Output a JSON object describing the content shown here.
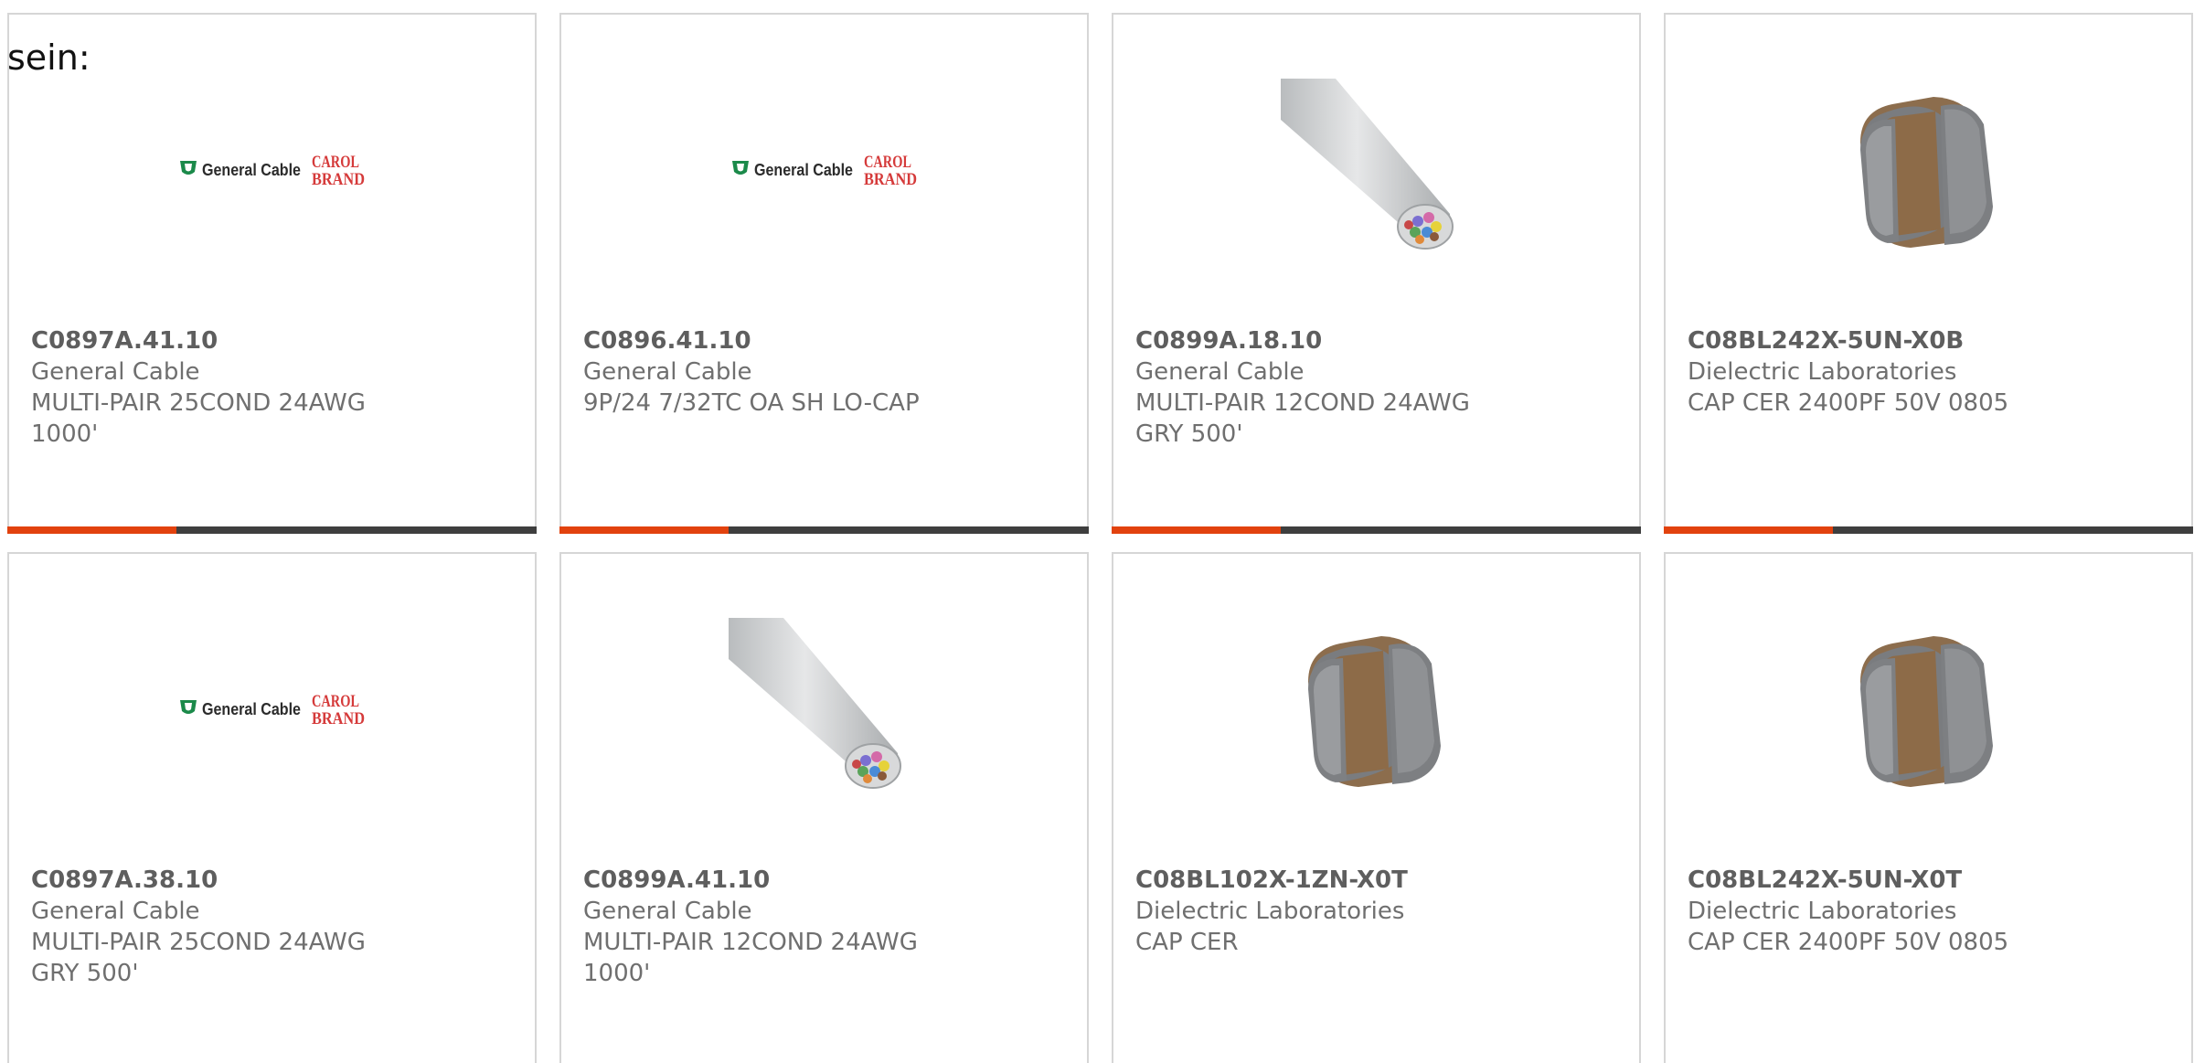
{
  "intro_text": "sein:",
  "colors": {
    "accent": "#e2420e",
    "bar_dark": "#3e3e3e",
    "card_border": "#d6d6d6",
    "text": "#6f6f6f"
  },
  "products": [
    {
      "part_number": "C0897A.41.10",
      "manufacturer": "General Cable",
      "description": [
        "MULTI-PAIR 25COND 24AWG",
        "1000'"
      ],
      "image": "general-cable-carol-brand-logo",
      "logo_text": {
        "brand": "General Cable",
        "sub1": "CAROL",
        "sub2": "BRAND"
      },
      "highlight_fraction": 0.32
    },
    {
      "part_number": "C0896.41.10",
      "manufacturer": "General Cable",
      "description": [
        "9P/24 7/32TC OA SH LO-CAP"
      ],
      "image": "general-cable-carol-brand-logo",
      "logo_text": {
        "brand": "General Cable",
        "sub1": "CAROL",
        "sub2": "BRAND"
      },
      "highlight_fraction": 0.32
    },
    {
      "part_number": "C0899A.18.10",
      "manufacturer": "General Cable",
      "description": [
        "MULTI-PAIR 12COND 24AWG",
        "GRY 500'"
      ],
      "image": "multi-conductor-cable-photo",
      "highlight_fraction": 0.32
    },
    {
      "part_number": "C08BL242X-5UN-X0B",
      "manufacturer": "Dielectric Laboratories",
      "description": [
        "CAP CER 2400PF 50V 0805"
      ],
      "image": "ceramic-capacitor-photo",
      "highlight_fraction": 0.32
    },
    {
      "part_number": "C0897A.38.10",
      "manufacturer": "General Cable",
      "description": [
        "MULTI-PAIR 25COND 24AWG",
        "GRY 500'"
      ],
      "image": "general-cable-carol-brand-logo",
      "logo_text": {
        "brand": "General Cable",
        "sub1": "CAROL",
        "sub2": "BRAND"
      },
      "highlight_fraction": null
    },
    {
      "part_number": "C0899A.41.10",
      "manufacturer": "General Cable",
      "description": [
        "MULTI-PAIR 12COND 24AWG",
        "1000'"
      ],
      "image": "multi-conductor-cable-photo",
      "highlight_fraction": null
    },
    {
      "part_number": "C08BL102X-1ZN-X0T",
      "manufacturer": "Dielectric Laboratories",
      "description": [
        "CAP CER"
      ],
      "image": "ceramic-capacitor-photo",
      "highlight_fraction": null
    },
    {
      "part_number": "C08BL242X-5UN-X0T",
      "manufacturer": "Dielectric Laboratories",
      "description": [
        "CAP CER 2400PF 50V 0805"
      ],
      "image": "ceramic-capacitor-photo",
      "highlight_fraction": null
    }
  ]
}
